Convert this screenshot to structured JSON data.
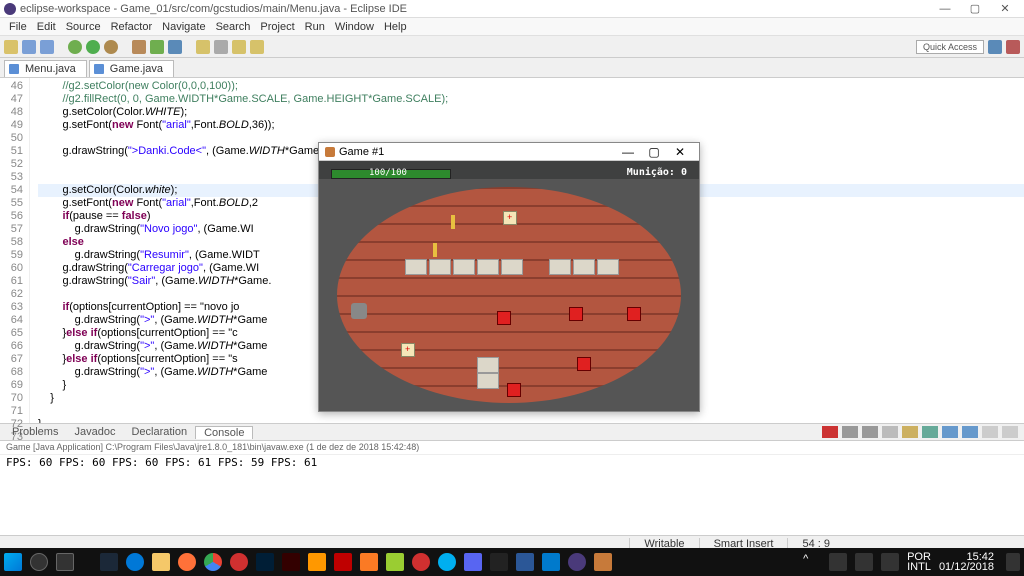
{
  "window": {
    "title": "eclipse-workspace - Game_01/src/com/gcstudios/main/Menu.java - Eclipse IDE"
  },
  "menu": [
    "File",
    "Edit",
    "Source",
    "Refactor",
    "Navigate",
    "Search",
    "Project",
    "Run",
    "Window",
    "Help"
  ],
  "quick_access": "Quick Access",
  "tabs": [
    {
      "label": "Menu.java",
      "active": true
    },
    {
      "label": "Game.java",
      "active": false
    }
  ],
  "lines": {
    "start": 46,
    "end": 73
  },
  "code": [
    "        //g2.setColor(new Color(0,0,0,100));",
    "        //g2.fillRect(0, 0, Game.WIDTH*Game.SCALE, Game.HEIGHT*Game.SCALE);",
    "        g.setColor(Color.WHITE);",
    "        g.setFont(new Font(\"arial\",Font.BOLD,36));",
    "",
    "        g.drawString(\">Danki.Code<\", (Game.WIDTH*Game.SCALE) / 2 - 110, (Game.HEIGHT*Game.SCALE) / 2 - 160);",
    "",
    "",
    "        g.setColor(Color.white);",
    "        g.setFont(new Font(\"arial\",Font.BOLD,2",
    "        if(pause == false)",
    "            g.drawString(\"Novo jogo\", (Game.WI",
    "        else",
    "            g.drawString(\"Resumir\", (Game.WIDT",
    "        g.drawString(\"Carregar jogo\", (Game.WI",
    "        g.drawString(\"Sair\", (Game.WIDTH*Game.",
    "",
    "        if(options[currentOption] == \"novo jo",
    "            g.drawString(\">\", (Game.WIDTH*Game",
    "        }else if(options[currentOption] == \"c",
    "            g.drawString(\">\", (Game.WIDTH*Game",
    "        }else if(options[currentOption] == \"s",
    "            g.drawString(\">\", (Game.WIDTH*Game",
    "        }",
    "    }",
    "",
    "}"
  ],
  "bottom_tabs": [
    "Problems",
    "Javadoc",
    "Declaration",
    "Console"
  ],
  "console_info": "Game [Java Application] C:\\Program Files\\Java\\jre1.8.0_181\\bin\\javaw.exe (1 de dez de 2018 15:42:48)",
  "console_lines": [
    "FPS: 60",
    "FPS: 60",
    "FPS: 60",
    "FPS: 61",
    "FPS: 59",
    "FPS: 61"
  ],
  "status": {
    "writable": "Writable",
    "insert": "Smart Insert",
    "pos": "54 : 9"
  },
  "game": {
    "title": "Game #1",
    "health": "100/100",
    "ammo": "Munição: 0"
  },
  "clock": {
    "lang": "POR",
    "kb": "INTL",
    "time": "15:42",
    "date": "01/12/2018"
  }
}
